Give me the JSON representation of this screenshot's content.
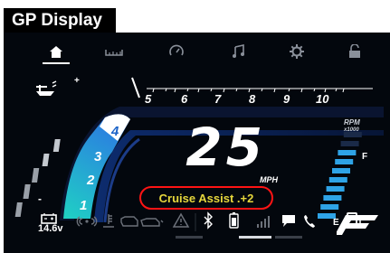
{
  "title": "GP Display",
  "topbar": {
    "icons": [
      "home-icon",
      "ruler-icon",
      "gauge-icon",
      "music-icon",
      "settings-icon",
      "lock-icon"
    ],
    "active": "home-icon"
  },
  "gauge": {
    "gears": [
      "1",
      "2",
      "3",
      "4"
    ],
    "rpm_ticks": [
      "5",
      "6",
      "7",
      "8",
      "9",
      "10"
    ],
    "rpm_unit": "RPM",
    "rpm_multiplier": "x1000",
    "speed": "25",
    "speed_unit": "MPH",
    "fuel_full_label": "F",
    "fuel_empty_label": "E",
    "fuel_level_fraction": 0.8,
    "trim_indicator_label": "Cruise Assist",
    "cruise_assist_setting": "+2"
  },
  "cruise_assist": {
    "label": "Cruise Assist .+2"
  },
  "bottombar": {
    "voltage": "14.6v",
    "left_icons": [
      "battery-icon",
      "signal-wave-icon",
      "engine-temp-icon",
      "oil-can-icon",
      "oil-pressure-icon",
      "warning-triangle-icon"
    ],
    "right_icons": [
      "bluetooth-icon",
      "phone-battery-icon",
      "cell-signal-icon",
      "message-icon",
      "phone-icon"
    ],
    "brand": "F"
  },
  "colors": {
    "accent_blue": "#2ea3e6",
    "cyan": "#22c6d8",
    "cruise_text": "#e6d73c",
    "cruise_border": "#ff1414"
  }
}
